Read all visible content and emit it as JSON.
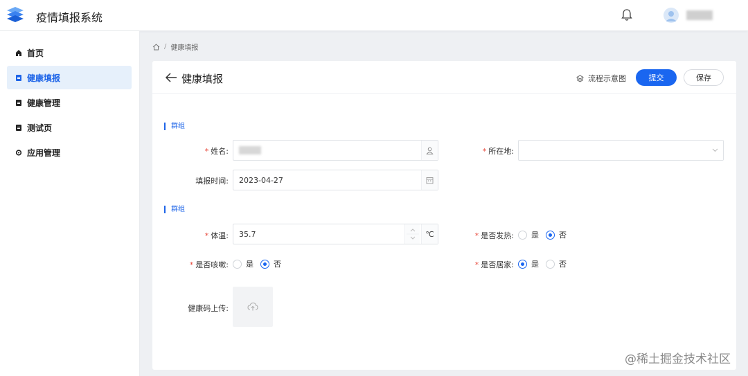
{
  "header": {
    "app_title": "疫情填报系统",
    "username": "user"
  },
  "sidebar": {
    "items": [
      {
        "label": "首页",
        "icon": "home-icon"
      },
      {
        "label": "健康填报",
        "icon": "document-icon",
        "active": true
      },
      {
        "label": "健康管理",
        "icon": "document-icon"
      },
      {
        "label": "测试页",
        "icon": "document-icon"
      },
      {
        "label": "应用管理",
        "icon": "settings-dot-icon"
      }
    ]
  },
  "breadcrumb": {
    "separator": "/",
    "current": "健康填报"
  },
  "page": {
    "title": "健康填报",
    "flow_link": "流程示意图",
    "submit_label": "提交",
    "save_label": "保存"
  },
  "form": {
    "section1_label": "群组",
    "section2_label": "群组",
    "required_mark": "*",
    "name_label": "姓名:",
    "name_value": "张三",
    "location_label": "所在地:",
    "location_value": "",
    "date_label": "填报时间:",
    "date_value": "2023-04-27",
    "temp_label": "体温:",
    "temp_value": "35.7",
    "temp_unit": "℃",
    "fever_label": "是否发热:",
    "fever_options": [
      "是",
      "否"
    ],
    "fever_selected": "否",
    "cough_label": "是否咳嗽:",
    "cough_options": [
      "是",
      "否"
    ],
    "cough_selected": "否",
    "home_label": "是否居家:",
    "home_options": [
      "是",
      "否"
    ],
    "home_selected": "是",
    "upload_label": "健康码上传:"
  },
  "colors": {
    "primary": "#1a66f0",
    "required": "#e8493d",
    "active_bg": "#e6f0fb"
  },
  "watermark": "@稀土掘金技术社区"
}
